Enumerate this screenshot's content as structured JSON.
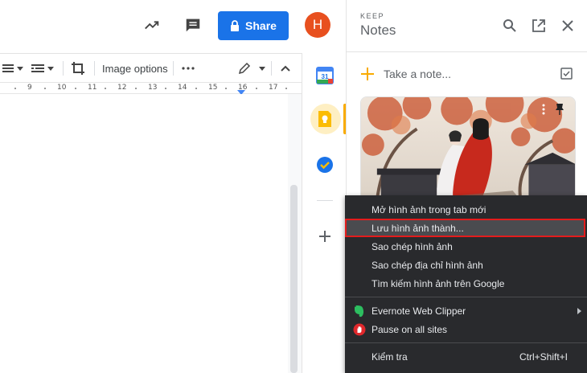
{
  "header": {
    "share_label": "Share",
    "avatar_initial": "H",
    "accent": "#1a73e8",
    "avatar_color": "#e8501f"
  },
  "toolbar": {
    "image_options_label": "Image options"
  },
  "ruler": {
    "labels": [
      "9",
      "10",
      "11",
      "12",
      "13",
      "14",
      "15",
      "16",
      "17"
    ]
  },
  "keep": {
    "brand": "KEEP",
    "title": "Notes",
    "take_note_placeholder": "Take a note...",
    "accent": "#f9ab00"
  },
  "context_menu": {
    "items": [
      "Mở hình ảnh trong tab mới",
      "Lưu hình ảnh thành...",
      "Sao chép hình ảnh",
      "Sao chép địa chỉ hình ảnh",
      "Tìm kiếm hình ảnh trên Google"
    ],
    "extensions": [
      "Evernote Web Clipper",
      "Pause on all sites"
    ],
    "inspect_label": "Kiểm tra",
    "inspect_shortcut": "Ctrl+Shift+I",
    "highlight_color": "#e31c1c"
  }
}
